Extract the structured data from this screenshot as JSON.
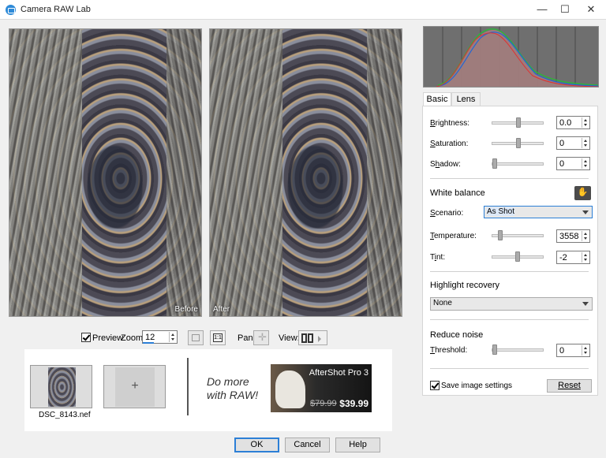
{
  "window": {
    "title": "Camera RAW Lab",
    "minimize": "—",
    "maximize": "☐",
    "close": "✕",
    "icon": "camera-icon"
  },
  "preview": {
    "before_label": "Before",
    "after_label": "After"
  },
  "controls": {
    "preview_label": "Preview",
    "preview_checked": true,
    "zoom_label": "Zoom:",
    "zoom_value": "12",
    "pan_label": "Pan:",
    "view_label": "View:"
  },
  "filmstrip": {
    "file_name": "DSC_8143.nef",
    "add_symbol": "+",
    "promo_line1": "Do more",
    "promo_line2": "with RAW!",
    "ad_title": "AfterShot Pro 3",
    "ad_old_price": "$79.99",
    "ad_new_price": "$39.99"
  },
  "tabs": {
    "basic": "Basic",
    "lens": "Lens"
  },
  "basic": {
    "brightness": {
      "label_u": "B",
      "label_rest": "rightness:",
      "value": "0.0",
      "position": 0.5
    },
    "saturation": {
      "label_u": "S",
      "label_rest": "aturation:",
      "value": "0",
      "position": 0.5
    },
    "shadow": {
      "label_pre": "S",
      "label_u": "h",
      "label_rest": "adow:",
      "value": "0",
      "position": 0.0
    },
    "white_balance_title": "White balance",
    "scenario_label_u": "S",
    "scenario_label_rest": "cenario:",
    "scenario_value": "As Shot",
    "temperature": {
      "label_u": "T",
      "label_rest": "emperature:",
      "value": "3558",
      "position": 0.12
    },
    "tint": {
      "label_pre": "T",
      "label_u": "i",
      "label_rest": "nt:",
      "value": "-2",
      "position": 0.5
    },
    "highlight_title": "Highlight recovery",
    "highlight_value": "None",
    "noise_title": "Reduce noise",
    "threshold": {
      "label_u": "T",
      "label_rest": "hreshold:",
      "value": "0",
      "position": 0.0
    },
    "save_settings_label": "Save image settings",
    "save_settings_checked": true,
    "reset_label": "Reset"
  },
  "buttons": {
    "ok": "OK",
    "cancel": "Cancel",
    "help": "Help"
  },
  "colors": {
    "accent": "#2c7fd6",
    "histogram_bg": "#6f6f6f"
  }
}
